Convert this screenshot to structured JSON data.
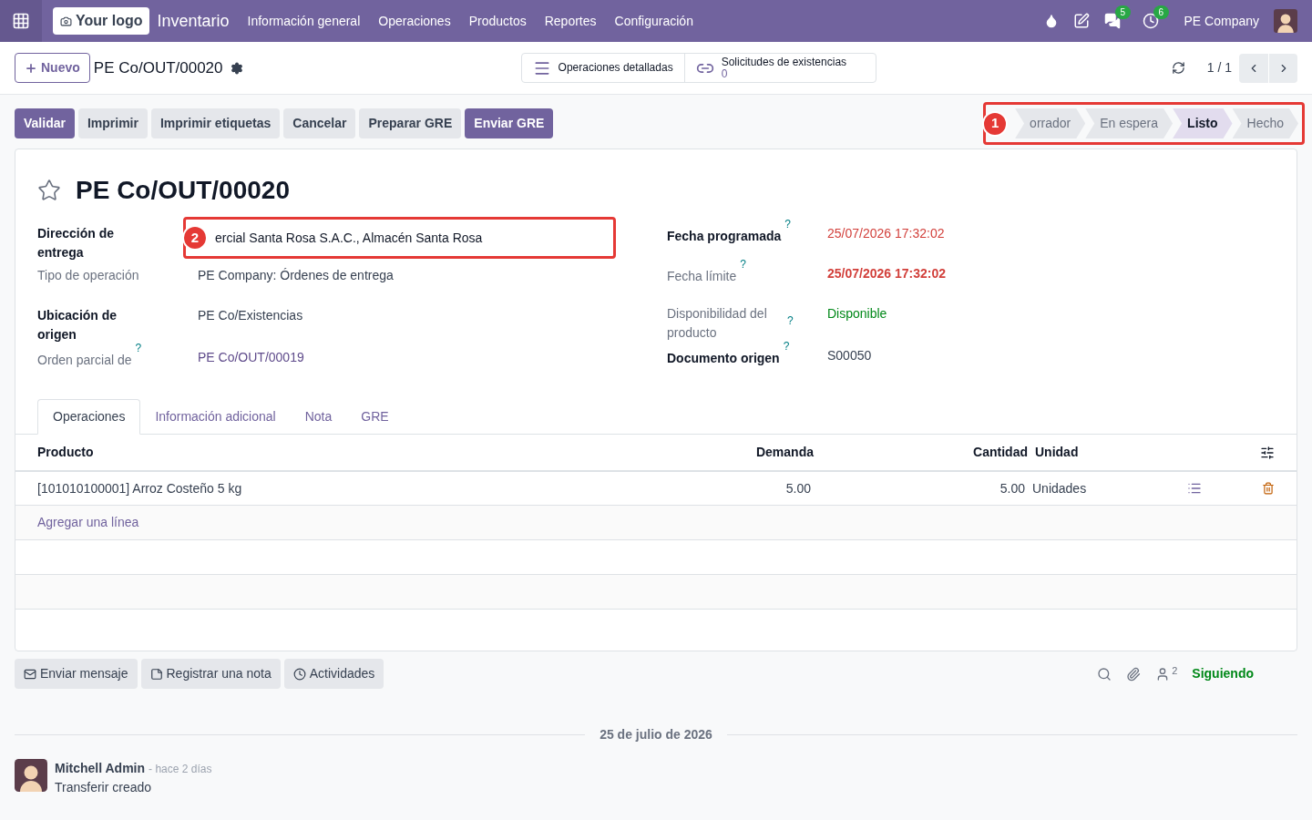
{
  "navbar": {
    "logo": "Your logo",
    "app": "Inventario",
    "menu": [
      "Información general",
      "Operaciones",
      "Productos",
      "Reportes",
      "Configuración"
    ],
    "messages_count": "5",
    "activities_count": "6",
    "company": "PE Company"
  },
  "control_panel": {
    "new_button": "Nuevo",
    "breadcrumb": "PE Co/OUT/00020",
    "smart_buttons": [
      {
        "kind": "list",
        "label": "Operaciones detalladas"
      },
      {
        "kind": "link",
        "label": "Solicitudes de existencias",
        "value": "0"
      }
    ],
    "pager": "1 / 1"
  },
  "actions": [
    {
      "label": "Validar",
      "primary": true
    },
    {
      "label": "Imprimir",
      "primary": false
    },
    {
      "label": "Imprimir etiquetas",
      "primary": false
    },
    {
      "label": "Cancelar",
      "primary": false
    },
    {
      "label": "Preparar GRE",
      "primary": false
    },
    {
      "label": "Enviar GRE",
      "primary": true
    }
  ],
  "statusbar": {
    "annotation": "1",
    "stages": [
      {
        "label": "orrador",
        "selected": false
      },
      {
        "label": "En espera",
        "selected": false
      },
      {
        "label": "Listo",
        "selected": true
      },
      {
        "label": "Hecho",
        "selected": false
      }
    ]
  },
  "form": {
    "title": "PE Co/OUT/00020",
    "starred": false,
    "left_fields": [
      {
        "label": "Dirección de entrega",
        "strong": true,
        "value": "ercial Santa Rosa S.A.C., Almacén Santa Rosa",
        "kind": "field",
        "annotation": "2"
      },
      {
        "label": "Tipo de operación",
        "strong": false,
        "value": "PE Company: Órdenes de entrega",
        "kind": "plain"
      },
      {
        "label": "Ubicación de origen",
        "strong": true,
        "value": "PE Co/Existencias",
        "kind": "plain"
      },
      {
        "label": "Orden parcial de",
        "strong": false,
        "help": "?",
        "value": "PE Co/OUT/00019",
        "kind": "link"
      }
    ],
    "right_fields": [
      {
        "label": "Fecha programada",
        "strong": true,
        "help": "?",
        "value": "25/07/2026 17:32:02",
        "kind": "danger"
      },
      {
        "label": "Fecha límite",
        "strong": false,
        "help": "?",
        "value": "25/07/2026 17:32:02",
        "kind": "danger_bold"
      },
      {
        "label": "Disponibilidad del producto",
        "strong": false,
        "help": "?",
        "value": "Disponible",
        "kind": "success"
      },
      {
        "label": "Documento origen",
        "strong": true,
        "help": "?",
        "value": "S00050",
        "kind": "plain"
      }
    ]
  },
  "tabs": [
    {
      "label": "Operaciones",
      "selected": true
    },
    {
      "label": "Información adicional",
      "selected": false
    },
    {
      "label": "Nota",
      "selected": false
    },
    {
      "label": "GRE",
      "selected": false
    }
  ],
  "table": {
    "columns": [
      "Producto",
      "Demanda",
      "Cantidad",
      "Unidad"
    ],
    "rows": [
      {
        "product": "[101010100001] Arroz Costeño 5 kg",
        "demand": "5.00",
        "quantity": "5.00",
        "unit": "Unidades"
      }
    ],
    "add_line": "Agregar una línea"
  },
  "chatter": {
    "buttons": [
      {
        "kind": "mail",
        "label": "Enviar mensaje"
      },
      {
        "kind": "note",
        "label": "Registrar una nota"
      },
      {
        "kind": "clock",
        "label": "Actividades"
      }
    ],
    "followers": "2",
    "following": "Siguiendo",
    "date": "25 de julio de 2026",
    "messages": [
      {
        "author": "Mitchell Admin",
        "time": "- hace 2 días",
        "body": "Transferir creado"
      }
    ]
  }
}
